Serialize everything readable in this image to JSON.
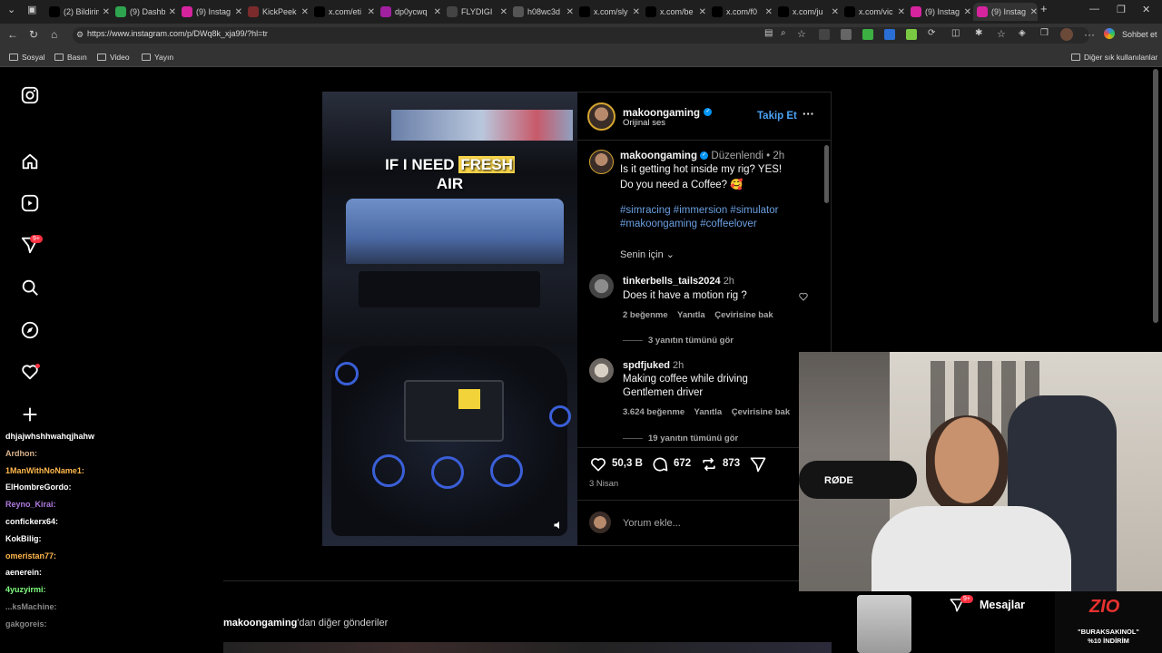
{
  "browser": {
    "tabs": [
      {
        "label": "(2) Bildirim",
        "icon": "x-icon",
        "color": "#000000"
      },
      {
        "label": "(9) Dashb",
        "icon": "chart-icon",
        "color": "#2ea44f"
      },
      {
        "label": "(9) Instag",
        "icon": "instagram-icon",
        "color": "#d6249f"
      },
      {
        "label": "KickPeek",
        "icon": "kickpeek-icon",
        "color": "#7b2b2b"
      },
      {
        "label": "x.com/eti",
        "icon": "x-icon",
        "color": "#000000"
      },
      {
        "label": "dp0ycwq",
        "icon": "d-icon",
        "color": "#a020a0"
      },
      {
        "label": "FLYDIGI",
        "icon": "flydigi-icon",
        "color": "#444444"
      },
      {
        "label": "h08wc3d",
        "icon": "globe-icon",
        "color": "#555555"
      },
      {
        "label": "x.com/sly",
        "icon": "x-icon",
        "color": "#000000"
      },
      {
        "label": "x.com/be",
        "icon": "x-icon",
        "color": "#000000"
      },
      {
        "label": "x.com/f0",
        "icon": "x-icon",
        "color": "#000000"
      },
      {
        "label": "x.com/ju",
        "icon": "x-icon",
        "color": "#000000"
      },
      {
        "label": "x.com/vic",
        "icon": "x-icon",
        "color": "#000000"
      },
      {
        "label": "(9) Instag",
        "icon": "instagram-icon",
        "color": "#d6249f"
      },
      {
        "label": "(9) Instag",
        "icon": "instagram-icon",
        "color": "#d6249f"
      }
    ],
    "url": "https://www.instagram.com/p/DWq8k_xja99/?hl=tr",
    "chat_button": "Sohbet et",
    "bookmarks": [
      "Sosyal",
      "Basın",
      "Video",
      "Yayın"
    ],
    "other_bookmarks": "Diğer sık kullanılanlar"
  },
  "instagram": {
    "notification_badge": "9+",
    "post": {
      "author": "makoongaming",
      "audio": "Orijinal ses",
      "follow_label": "Takip Et",
      "caption_author": "makoongaming",
      "edited": "Düzenlendi",
      "caption_time": "2h",
      "caption_line1": "Is it getting hot inside my rig? YES!",
      "caption_line2": "Do you need a Coffee? 🥰",
      "hashtags_line1": "#simracing #immersion #simulator",
      "hashtags_line2": "#makoongaming #coffeelover",
      "for_you": "Senin için",
      "video_overlay_pre": "IF I NEED",
      "video_overlay_highlight": "FRESH",
      "video_overlay_post": "AIR",
      "likes": "50,3 B",
      "comments_count": "672",
      "reposts": "873",
      "date": "3 Nisan",
      "add_comment": "Yorum ekle...",
      "more_posts_author": "makoongaming",
      "more_posts_suffix": "'dan diğer gönderiler"
    },
    "comments": [
      {
        "user": "tinkerbells_tails2024",
        "time": "2h",
        "text": "Does it have a motion rig ?",
        "likes": "2 beğenme",
        "reply": "Yanıtla",
        "translate": "Çevirisine bak",
        "view_replies": "3 yanıtın tümünü gör"
      },
      {
        "user": "spdfjuked",
        "time": "2h",
        "text_line1": "Making coffee while driving",
        "text_line2": "Gentlemen driver",
        "likes": "3.624 beğenme",
        "reply": "Yanıtla",
        "translate": "Çevirisine bak",
        "view_replies": "19 yanıtın tümünü gör"
      }
    ],
    "messages": {
      "label": "Mesajlar",
      "badge": "9+"
    }
  },
  "stream_chat": [
    {
      "user": "dhjajwhshhwahqjhahw",
      "color": "#ffffff"
    },
    {
      "user": "Ardhon:",
      "color": "#d9b38c"
    },
    {
      "user": "1ManWithNoName1:",
      "color": "#ffb84d"
    },
    {
      "user": "ElHombreGordo:",
      "color": "#ffffff"
    },
    {
      "user": "Reyno_Kirai:",
      "color": "#b07be0"
    },
    {
      "user": "confickerx64:",
      "color": "#ffffff"
    },
    {
      "user": "KokBilig:",
      "color": "#ffffff"
    },
    {
      "user": "omeristan77:",
      "color": "#ffb84d"
    },
    {
      "user": "aenerein:",
      "color": "#ffffff"
    },
    {
      "user": "4yuzyirmi:",
      "color": "#7fff7f"
    },
    {
      "user": "...ksMachine:",
      "color": "#888888"
    },
    {
      "user": "gakgoreis:",
      "color": "#888888"
    }
  ],
  "sponsor": {
    "brand": "ZIO",
    "line1": "\"BURAKSAKINOL\"",
    "line2": "%10 İNDİRİM"
  },
  "cam": {
    "mic_brand": "RØDE"
  }
}
